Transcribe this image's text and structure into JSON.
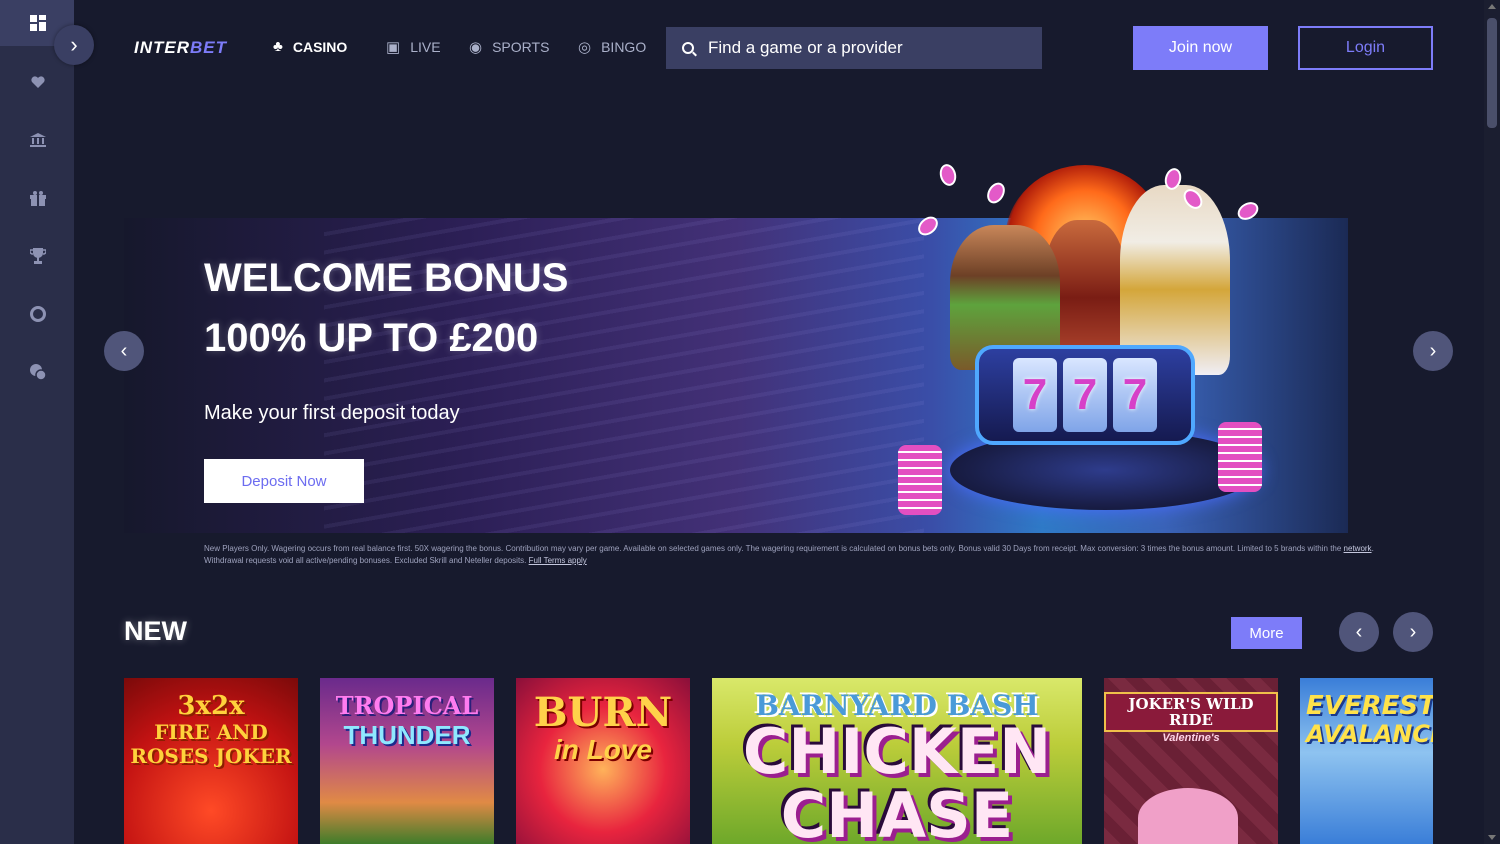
{
  "header": {
    "logo_inter": "INTER",
    "logo_bet": "BET",
    "nav": [
      {
        "label": "CASINO",
        "icon": "casino-icon",
        "active": true
      },
      {
        "label": "LIVE",
        "icon": "live-icon",
        "active": false
      },
      {
        "label": "SPORTS",
        "icon": "sports-icon",
        "active": false
      },
      {
        "label": "BINGO",
        "icon": "bingo-icon",
        "active": false
      }
    ],
    "search_placeholder": "Find a game or a provider",
    "join_label": "Join now",
    "login_label": "Login"
  },
  "sidebar": {
    "icons": [
      "dashboard-icon",
      "heart-icon",
      "bank-icon",
      "gift-icon",
      "trophy-icon",
      "support-icon",
      "chat-icon"
    ]
  },
  "banner": {
    "title_line1": "WELCOME BONUS",
    "title_line2": "100% UP TO £200",
    "subtitle": "Make your first deposit today",
    "cta_label": "Deposit Now",
    "slot_reels": [
      "7",
      "7",
      "7"
    ],
    "disclaimer_part1": "New Players Only. Wagering occurs from real balance first. 50X wagering the bonus. Contribution may vary per game. Available on selected games only. The wagering requirement is calculated on bonus bets only. Bonus valid 30 Days from receipt. Max conversion: 3 times the bonus amount. Limited to 5 brands within the ",
    "disclaimer_link1": "network",
    "disclaimer_part2": ". Withdrawal requests void all active/pending bonuses. Excluded Skrill and Neteller deposits. ",
    "disclaimer_link2": "Full Terms apply"
  },
  "new_section": {
    "title": "NEW",
    "more_label": "More",
    "games": [
      {
        "title": "3x2x",
        "subtitle": "FIRE AND ROSES JOKER"
      },
      {
        "title": "TROPICAL",
        "subtitle": "THUNDER"
      },
      {
        "title": "BURN",
        "subtitle": "in Love"
      },
      {
        "title": "BARNYARD BASH",
        "subtitle": "CHICKEN CHASE"
      },
      {
        "title": "JOKER'S WILD RIDE",
        "subtitle": "Valentine's"
      },
      {
        "title": "EVEREST",
        "subtitle": "AVALANCHE"
      }
    ]
  },
  "colors": {
    "accent": "#7d7cf9",
    "background": "#171a2d",
    "sidebar": "#2a2e49"
  }
}
